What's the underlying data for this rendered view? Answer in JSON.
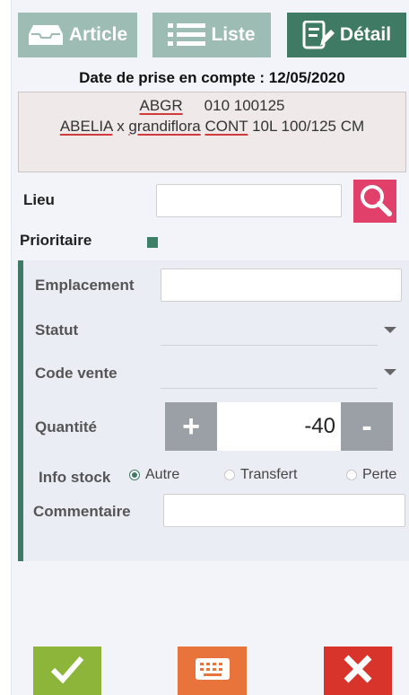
{
  "tabs": {
    "article": "Article",
    "liste": "Liste",
    "detail": "Détail"
  },
  "header": {
    "date_line": "Date de prise en compte : 12/05/2020"
  },
  "article": {
    "code": "ABGR",
    "number": "010 100125",
    "name_part1": "ABELIA",
    "name_x": "x",
    "name_part2": "grandiflora",
    "name_part3": "CONT",
    "name_rest": "10L 100/125 CM"
  },
  "form": {
    "lieu_label": "Lieu",
    "lieu_value": "",
    "prioritaire_label": "Prioritaire",
    "emplacement_label": "Emplacement",
    "emplacement_value": "",
    "statut_label": "Statut",
    "statut_value": "",
    "code_vente_label": "Code vente",
    "code_vente_value": "",
    "quantite_label": "Quantité",
    "quantite_value": "-40",
    "plus_label": "+",
    "minus_label": "-",
    "info_stock_label": "Info stock",
    "info_stock_options": [
      "Autre",
      "Transfert",
      "Perte"
    ],
    "info_stock_selected": "Autre",
    "commentaire_label": "Commentaire",
    "commentaire_value": ""
  },
  "colors": {
    "accent": "#3e7a64",
    "tab_inactive": "#9dbcb3",
    "search": "#e04069",
    "ok": "#8db539",
    "keyboard": "#e8733b",
    "cancel": "#d8342b"
  },
  "icons": {
    "article": "inbox-tray-icon",
    "liste": "list-icon",
    "detail": "edit-document-icon",
    "search": "search-icon",
    "ok": "check-icon",
    "keyboard": "keyboard-icon",
    "cancel": "close-icon"
  }
}
